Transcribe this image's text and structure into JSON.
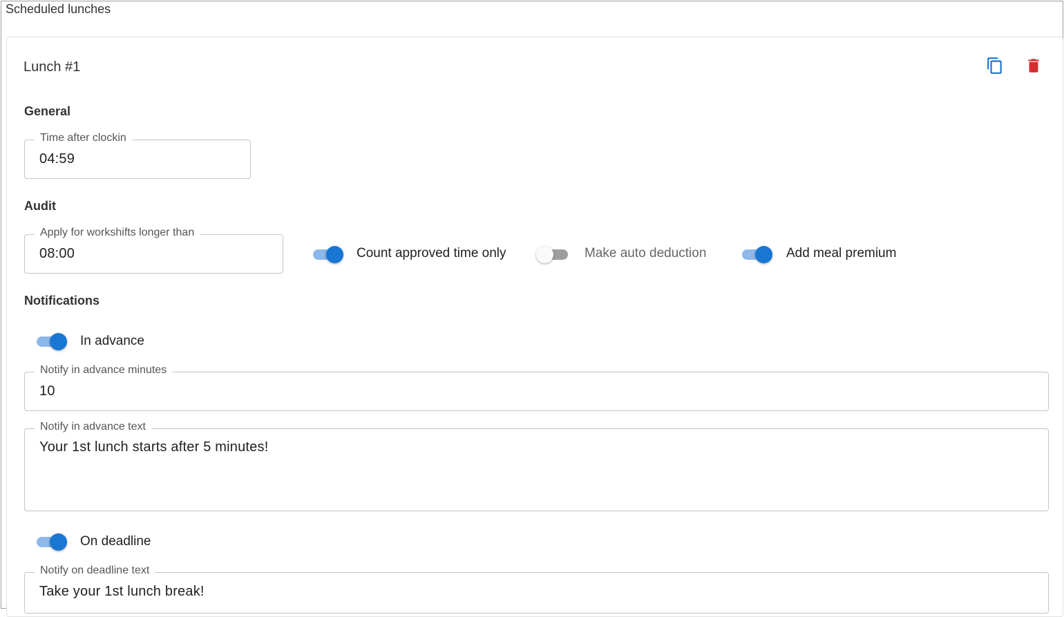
{
  "section": {
    "title": "Scheduled lunches"
  },
  "lunch": {
    "title": "Lunch #1",
    "actions": {
      "copy_icon": "content-copy-icon",
      "delete_icon": "delete-icon",
      "copy_color": "#1976d2",
      "delete_color": "#d32f2f"
    }
  },
  "general": {
    "title": "General",
    "time_after_clockin": {
      "label": "Time after clockin",
      "value": "04:59"
    }
  },
  "audit": {
    "title": "Audit",
    "apply_longer_than": {
      "label": "Apply for workshifts longer than",
      "value": "08:00"
    },
    "toggles": [
      {
        "label": "Count approved time only",
        "checked": true
      },
      {
        "label": "Make auto deduction",
        "checked": false
      },
      {
        "label": "Add meal premium",
        "checked": true
      }
    ]
  },
  "notifications": {
    "title": "Notifications",
    "in_advance": {
      "label": "In advance",
      "checked": true,
      "minutes": {
        "label": "Notify in advance minutes",
        "value": "10"
      },
      "text": {
        "label": "Notify in advance text",
        "value": "Your 1st lunch starts after 5 minutes!"
      }
    },
    "on_deadline": {
      "label": "On deadline",
      "checked": true,
      "text": {
        "label": "Notify on deadline text",
        "value": "Take your 1st lunch break!"
      }
    }
  },
  "colors": {
    "accent": "#1976d2",
    "accent_light": "#8cb8ea",
    "danger": "#d32f2f",
    "border": "#c4c4c4"
  }
}
